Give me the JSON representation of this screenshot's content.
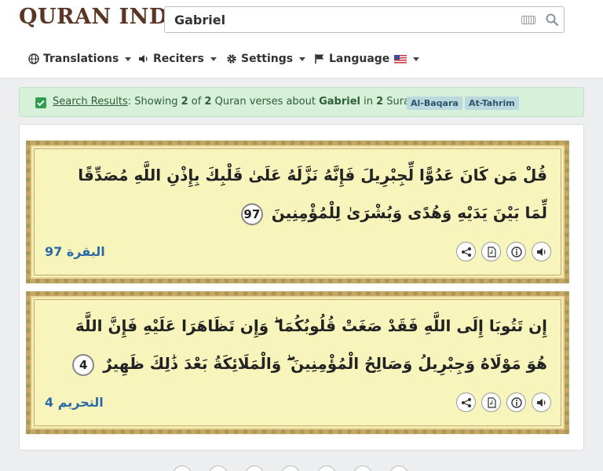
{
  "app": {
    "logo_text": "Quran Index"
  },
  "search": {
    "value": "Gabriel"
  },
  "menu": {
    "translations": "Translations",
    "reciters": "Reciters",
    "settings": "Settings",
    "language": "Language"
  },
  "banner": {
    "link": "Search Results",
    "p1": ": Showing ",
    "count": "2",
    "p2": " of ",
    "total": "2",
    "p3": " Quran verses about ",
    "term": "Gabriel",
    "p4": " in ",
    "surahs": "2",
    "p5": " Surahs",
    "tags": [
      "Al-Baqara",
      "At-Tahrim"
    ]
  },
  "verses": [
    {
      "text": "قُلْ مَن كَانَ عَدُوًّا لِّجِبْرِيلَ فَإِنَّهُ نَزَّلَهُ عَلَىٰ قَلْبِكَ بِإِذْنِ اللَّهِ مُصَدِّقًا لِّمَا بَيْنَ يَدَيْهِ وَهُدًى وَبُشْرَىٰ لِلْمُؤْمِنِينَ",
      "number": "97",
      "reference": "البقرة 97"
    },
    {
      "text": "إِن تَتُوبَا إِلَى اللَّهِ فَقَدْ صَغَتْ قُلُوبُكُمَا ۖ وَإِن تَظَاهَرَا عَلَيْهِ فَإِنَّ اللَّهَ هُوَ مَوْلَاهُ وَجِبْرِيلُ وَصَالِحُ الْمُؤْمِنِينَ ۖ وَالْمَلَائِكَةُ بَعْدَ ذَٰلِكَ ظَهِيرٌ",
      "number": "4",
      "reference": "التحريم 4"
    }
  ],
  "colors": {
    "accent": "#2b6aa7",
    "banner_bg": "#d6f0d9",
    "verse_bg": "#f8f5bc"
  },
  "icons": [
    "globe-icon",
    "speaker-icon",
    "gear-icon",
    "flag-icon",
    "us-flag-icon",
    "share-icon",
    "pdf-icon",
    "info-icon",
    "audio-icon",
    "keyboard-icon",
    "search-icon",
    "checkbox-icon"
  ]
}
